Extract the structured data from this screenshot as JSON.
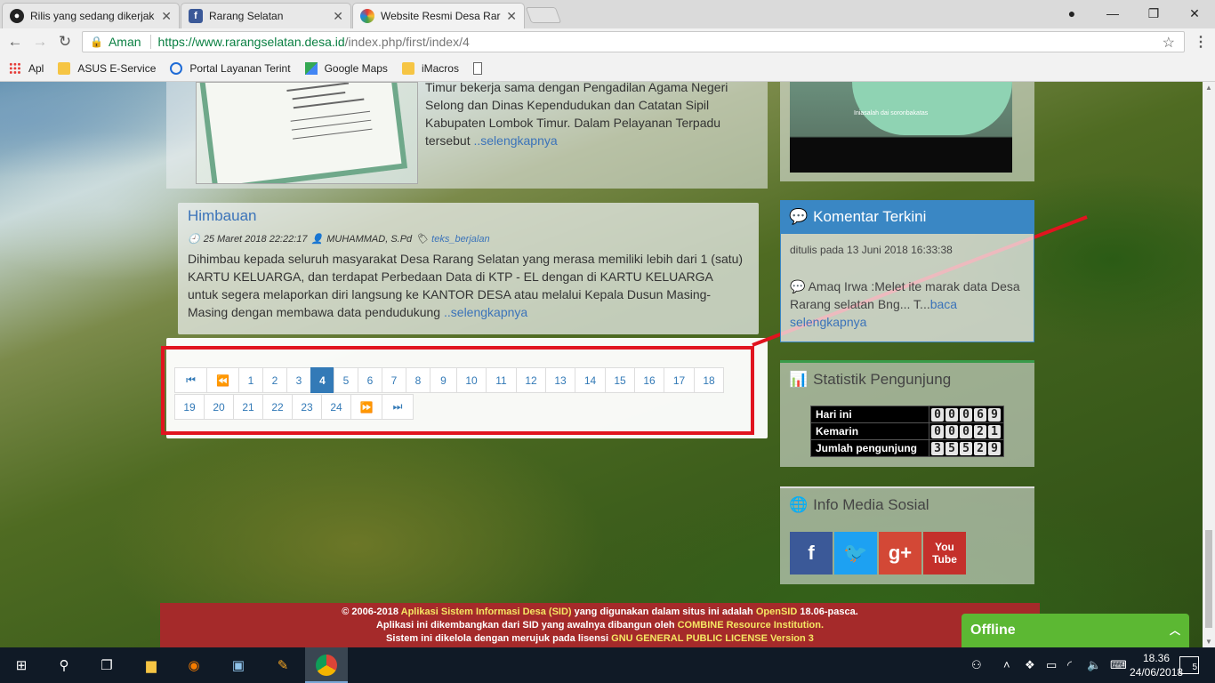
{
  "browser": {
    "tabs": [
      {
        "title": "Rilis yang sedang dikerjak",
        "icon": "github-icon"
      },
      {
        "title": "Rarang Selatan",
        "icon": "facebook-icon"
      },
      {
        "title": "Website Resmi Desa Rara",
        "icon": "site-icon"
      }
    ],
    "security_label": "Aman",
    "url_host": "https://www.rarangselatan.desa.id",
    "url_path": "/index.php/first/index/4",
    "bookmarks": [
      "Apl",
      "ASUS E-Service",
      "Portal Layanan Terint",
      "Google Maps",
      "iMacros"
    ]
  },
  "article1": {
    "text": "Timur bekerja sama dengan Pengadilan Agama Negeri Selong dan Dinas Kependudukan dan Catatan Sipil Kabupaten Lombok Timur. Dalam Pelayanan Terpadu tersebut",
    "more": "..selengkapnya"
  },
  "article2": {
    "title": "Himbauan",
    "date": "25 Maret 2018 22:22:17",
    "author": "MUHAMMAD, S.Pd",
    "tag": "teks_berjalan",
    "text": "Dihimbau kepada seluruh masyarakat Desa Rarang Selatan yang merasa memiliki lebih dari 1 (satu) KARTU KELUARGA, dan terdapat Perbedaan Data di KTP - EL dengan di KARTU KELUARGA untuk segera melaporkan diri langsung ke KANTOR DESA atau melalui Kepala Dusun Masing-Masing dengan membawa data pendudukung",
    "more": "..selengkapnya"
  },
  "pagination": {
    "first": "⏮",
    "prev": "⏪",
    "next": "⏩",
    "last": "⏭",
    "pages": [
      "1",
      "2",
      "3",
      "4",
      "5",
      "6",
      "7",
      "8",
      "9",
      "10",
      "11",
      "12",
      "13",
      "14",
      "15",
      "16",
      "17",
      "18",
      "19",
      "20",
      "21",
      "22",
      "23",
      "24"
    ],
    "active": "4"
  },
  "video": {
    "caption": "Iniasalah dai soronbakatas"
  },
  "komentar": {
    "heading": "Komentar Terkini",
    "date": "ditulis pada 13 Juni 2018 16:33:38",
    "text": "Amaq Irwa :Melet ite marak data Desa Rarang selatan Bng... T...",
    "more": "baca selengkapnya"
  },
  "statistik": {
    "heading": "Statistik Pengunjung",
    "rows": [
      {
        "label": "Hari ini",
        "value": "00069"
      },
      {
        "label": "Kemarin",
        "value": "00021"
      },
      {
        "label": "Jumlah pengunjung",
        "value": "35529"
      }
    ]
  },
  "media": {
    "heading": "Info Media Sosial",
    "items": [
      {
        "label": "f",
        "color": "#3b5998",
        "icon": "facebook-icon"
      },
      {
        "label": "🐦",
        "color": "#1da1f2",
        "icon": "twitter-icon"
      },
      {
        "label": "g+",
        "color": "#d34836",
        "icon": "google-plus-icon"
      },
      {
        "label": "You Tube",
        "color": "#c4302b",
        "icon": "youtube-icon"
      }
    ]
  },
  "footer": {
    "line1_a": "© 2006-2018",
    "line1_link": "Aplikasi Sistem Informasi Desa (SID)",
    "line1_b": "yang digunakan dalam situs ini adalah",
    "line1_link2": "OpenSID",
    "line1_c": "18.06-pasca.",
    "line2_a": "Aplikasi ini dikembangkan dari SID yang awalnya dibangun oleh",
    "line2_link": "COMBINE Resource Institution.",
    "line3_a": "Sistem ini dikelola dengan merujuk pada lisensi",
    "line3_link": "GNU GENERAL PUBLIC LICENSE Version 3"
  },
  "chat": {
    "label": "Offline"
  },
  "taskbar": {
    "time": "18.36",
    "date": "24/06/2018",
    "notifications": "5"
  }
}
